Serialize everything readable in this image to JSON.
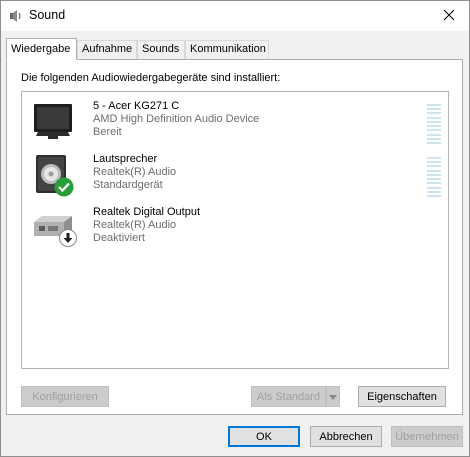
{
  "window": {
    "title": "Sound"
  },
  "icons": {
    "app": "speaker-icon",
    "close": "close-icon"
  },
  "tabs": [
    {
      "label": "Wiedergabe",
      "active": true
    },
    {
      "label": "Aufnahme",
      "active": false
    },
    {
      "label": "Sounds",
      "active": false
    },
    {
      "label": "Kommunikation",
      "active": false
    }
  ],
  "panel": {
    "heading": "Die folgenden Audiowiedergabegeräte sind installiert:"
  },
  "devices": [
    {
      "name": "5 - Acer KG271 C",
      "driver": "AMD High Definition Audio Device",
      "status": "Bereit",
      "icon": "monitor-icon",
      "badge": ""
    },
    {
      "name": "Lautsprecher",
      "driver": "Realtek(R) Audio",
      "status": "Standardgerät",
      "icon": "speaker-device-icon",
      "badge": "default-checkmark-icon"
    },
    {
      "name": "Realtek Digital Output",
      "driver": "Realtek(R) Audio",
      "status": "Deaktiviert",
      "icon": "digital-output-icon",
      "badge": "disabled-arrow-icon"
    }
  ],
  "buttons": {
    "configure": "Konfigurieren",
    "set_default": "Als Standard",
    "properties": "Eigenschaften",
    "ok": "OK",
    "cancel": "Abbrechen",
    "apply": "Übernehmen"
  },
  "colors": {
    "accent": "#0078d7",
    "check_badge": "#2a9d3a",
    "level_meter": "#cfe3f1",
    "disabled_text": "#a0a0a0"
  }
}
